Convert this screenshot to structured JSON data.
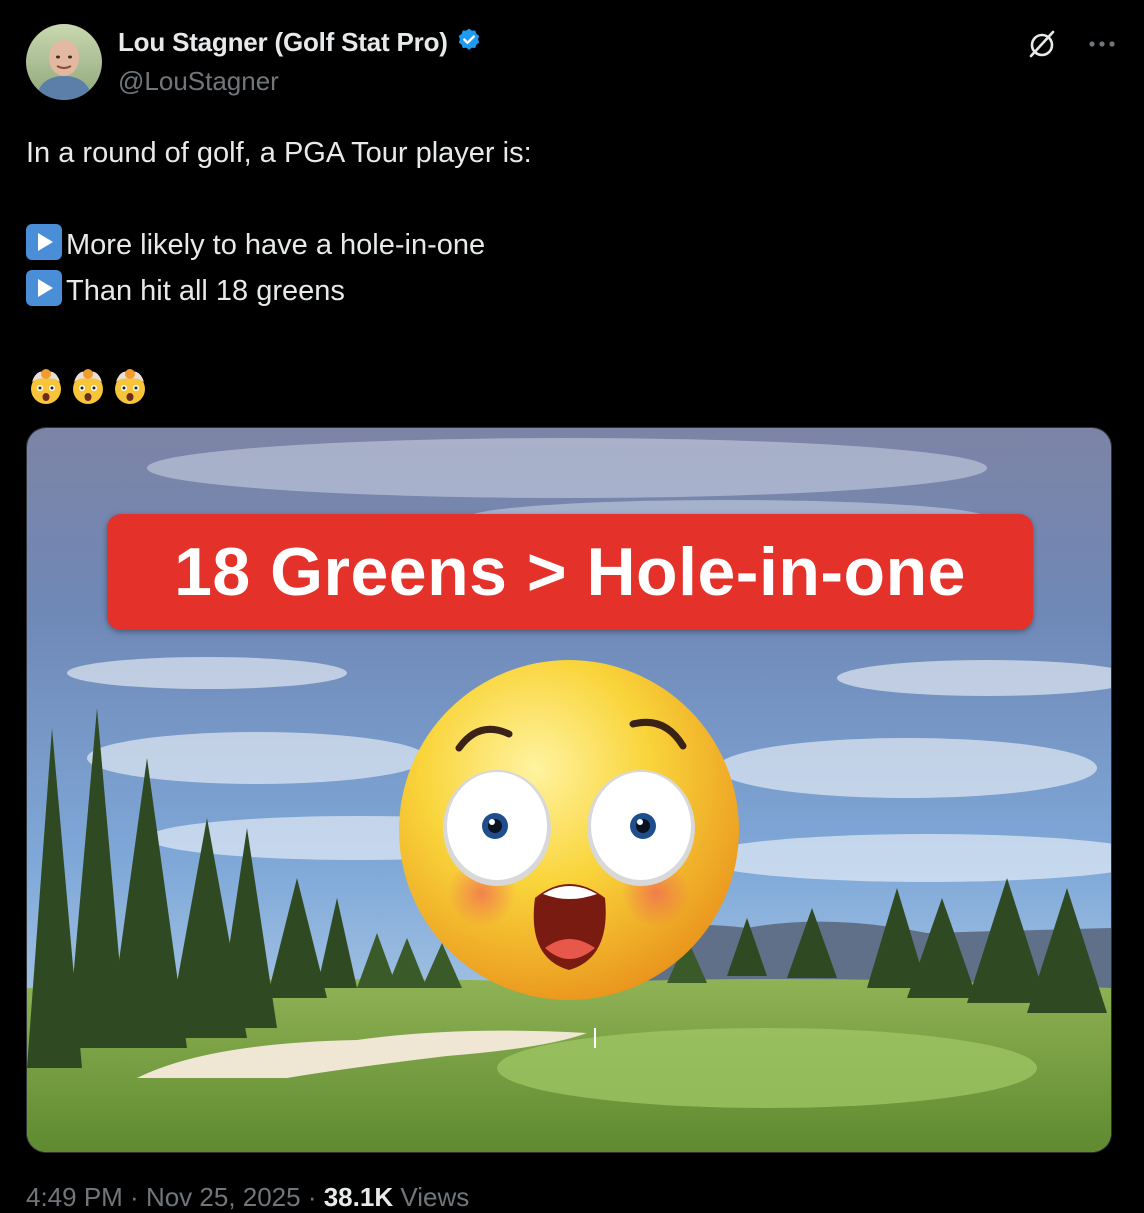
{
  "author": {
    "display_name": "Lou Stagner (Golf Stat Pro)",
    "handle": "@LouStagner",
    "verified": true,
    "verified_color": "#1d9bf0"
  },
  "header_icons": [
    "grok-icon",
    "more-icon"
  ],
  "tweet": {
    "intro": "In a round of golf, a PGA Tour player is:",
    "bullets": [
      "More likely to have a hole-in-one",
      "Than hit all 18 greens"
    ],
    "reaction_emojis": [
      "exploding-head-emoji",
      "exploding-head-emoji",
      "exploding-head-emoji"
    ]
  },
  "media": {
    "banner_text": "18 Greens > Hole-in-one",
    "banner_color": "#e4322b"
  },
  "footer": {
    "time": "4:49 PM",
    "date": "Nov 25, 2025",
    "views_count": "38.1K",
    "views_label": "Views"
  }
}
